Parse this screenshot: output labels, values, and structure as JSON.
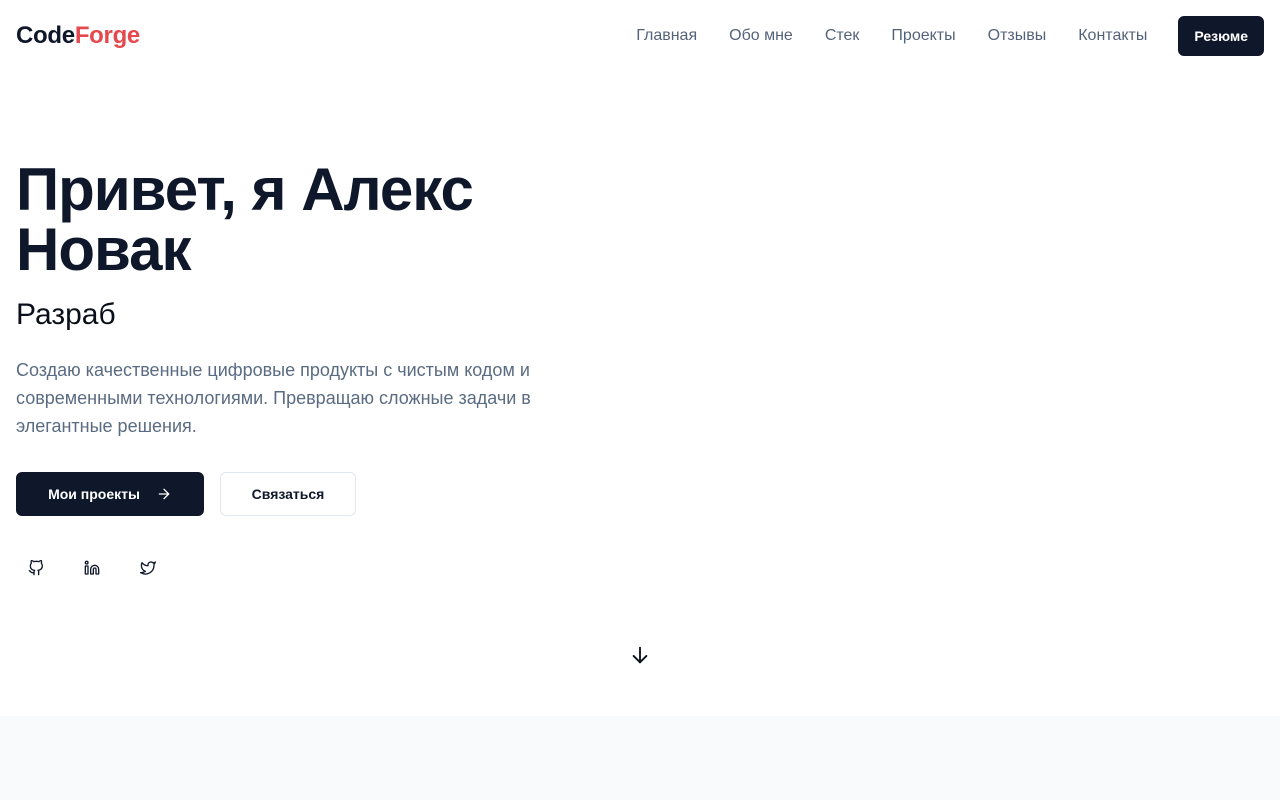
{
  "brand": {
    "part1": "Code",
    "part2": "Forge"
  },
  "nav": {
    "items": [
      {
        "label": "Главная"
      },
      {
        "label": "Обо мне"
      },
      {
        "label": "Стек"
      },
      {
        "label": "Проекты"
      },
      {
        "label": "Отзывы"
      },
      {
        "label": "Контакты"
      }
    ],
    "resume_label": "Резюме"
  },
  "hero": {
    "title_line1": "Привет, я Алекс",
    "title_line2": "Новак",
    "role": "Разраб",
    "description": "Создаю качественные цифровые продукты с чистым кодом и современными технологиями. Превращаю сложные задачи в элегантные решения.",
    "primary_button": "Мои проекты",
    "secondary_button": "Связаться"
  },
  "socials": [
    {
      "icon": "github-icon"
    },
    {
      "icon": "linkedin-icon"
    },
    {
      "icon": "twitter-icon"
    }
  ],
  "colors": {
    "primary": "#0f172a",
    "accent": "#e5484d",
    "muted_text": "#5a6b82",
    "section_bg": "#f8fafc"
  }
}
